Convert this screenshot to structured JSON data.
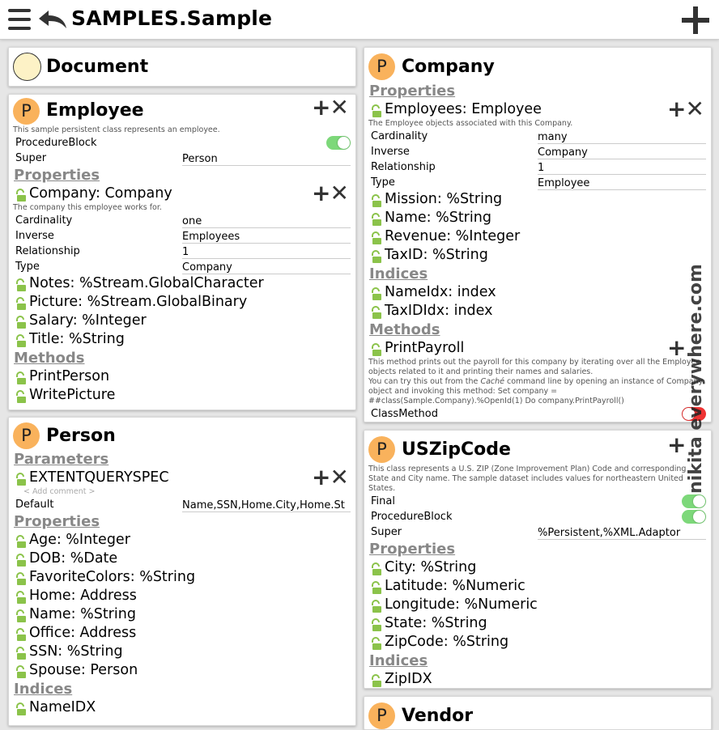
{
  "header": {
    "title": "SAMPLES.Sample"
  },
  "document": {
    "title": "Document"
  },
  "employee": {
    "icon": "P",
    "title": "Employee",
    "desc": "This sample persistent class represents an employee.",
    "procedure_block_label": "ProcedureBlock",
    "super_label": "Super",
    "super_value": "Person",
    "properties_heading": "Properties",
    "company_prop": "Company: Company",
    "company_desc": "The company this employee works for.",
    "rel": [
      {
        "k": "Cardinality",
        "v": "one"
      },
      {
        "k": "Inverse",
        "v": "Employees"
      },
      {
        "k": "Relationship",
        "v": "1"
      },
      {
        "k": "Type",
        "v": "Company"
      }
    ],
    "props": [
      "Notes: %Stream.GlobalCharacter",
      "Picture: %Stream.GlobalBinary",
      "Salary: %Integer",
      "Title: %String"
    ],
    "methods_heading": "Methods",
    "methods": [
      "PrintPerson",
      "WritePicture"
    ]
  },
  "person": {
    "icon": "P",
    "title": "Person",
    "parameters_heading": "Parameters",
    "param": "EXTENTQUERYSPEC",
    "add_comment": "< Add comment >",
    "default_label": "Default",
    "default_value": "Name,SSN,Home.City,Home.St",
    "properties_heading": "Properties",
    "props": [
      "Age: %Integer",
      "DOB: %Date",
      "FavoriteColors: %String",
      "Home: Address",
      "Name: %String",
      "Office: Address",
      "SSN: %String",
      "Spouse: Person"
    ],
    "indices_heading": "Indices",
    "indices": [
      "NameIDX"
    ]
  },
  "company": {
    "icon": "P",
    "title": "Company",
    "properties_heading": "Properties",
    "employees_prop": "Employees: Employee",
    "employees_desc": "The Employee objects associated with this Company.",
    "rel": [
      {
        "k": "Cardinality",
        "v": "many"
      },
      {
        "k": "Inverse",
        "v": "Company"
      },
      {
        "k": "Relationship",
        "v": "1"
      },
      {
        "k": "Type",
        "v": "Employee"
      }
    ],
    "props": [
      "Mission: %String",
      "Name: %String",
      "Revenue: %Integer",
      "TaxID: %String"
    ],
    "indices_heading": "Indices",
    "indices": [
      "NameIdx: index",
      "TaxIDIdx: index"
    ],
    "methods_heading": "Methods",
    "method": "PrintPayroll",
    "method_desc_1": "This method prints out the payroll for this company by iterating over all the Employee objects related to it and printing their names and salaries.",
    "method_desc_2a": "You can try this out from the ",
    "method_desc_2b": "Caché",
    "method_desc_2c": " command line by opening an instance of Company object and invoking this method: Set company = ##class(Sample.Company).%OpenId(1) Do company.PrintPayroll()",
    "classmethod_label": "ClassMethod"
  },
  "uszipcode": {
    "icon": "P",
    "title": "USZipCode",
    "desc": "This class represents a U.S. ZIP (Zone Improvement Plan) Code and corresponding State and City name. The sample dataset includes values for northeastern United States.",
    "final_label": "Final",
    "procedure_block_label": "ProcedureBlock",
    "super_label": "Super",
    "super_value": "%Persistent,%XML.Adaptor",
    "properties_heading": "Properties",
    "props": [
      "City: %String",
      "Latitude: %Numeric",
      "Longitude: %Numeric",
      "State: %String",
      "ZipCode: %String"
    ],
    "indices_heading": "Indices",
    "indices": [
      "ZipIDX"
    ]
  },
  "vendor": {
    "icon": "P",
    "title": "Vendor"
  },
  "watermark": "nikita everywhere.com",
  "colors": {
    "class_icon": "#f9b25c",
    "toggle_on": "#7dd87a",
    "toggle_off": "#e33333",
    "section": "#888888",
    "lock": "#8bc34a"
  }
}
